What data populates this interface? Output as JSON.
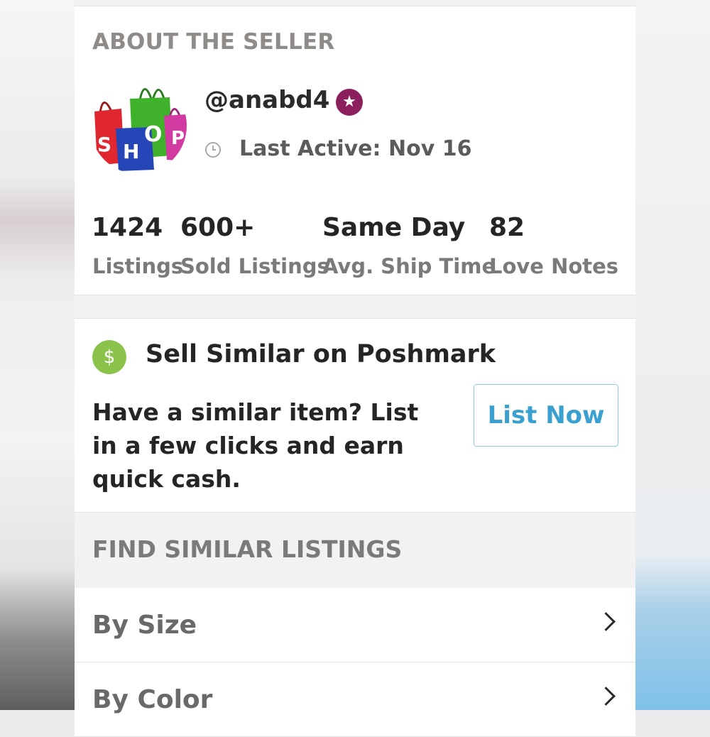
{
  "seller": {
    "section_title": "ABOUT THE SELLER",
    "username": "@anabd4",
    "last_active": "Last Active: Nov 16",
    "avatar_text": "SHOP",
    "stats": [
      {
        "value": "1424",
        "label": "Listings"
      },
      {
        "value": "600+",
        "label": "Sold Listings"
      },
      {
        "value": "Same Day",
        "label": "Avg. Ship Time"
      },
      {
        "value": "82",
        "label": "Love Notes"
      }
    ]
  },
  "sell_similar": {
    "icon_glyph": "$",
    "title": "Sell Similar on Poshmark",
    "description": "Have a similar item? List in a few clicks and earn quick cash.",
    "button_label": "List Now"
  },
  "find_similar": {
    "title": "FIND SIMILAR LISTINGS",
    "rows": [
      {
        "label": "By Size"
      },
      {
        "label": "By Color"
      }
    ]
  },
  "colors": {
    "badge": "#8c1f5e",
    "dollar_icon": "#8bc34a",
    "list_now_text": "#3aa0cf"
  }
}
